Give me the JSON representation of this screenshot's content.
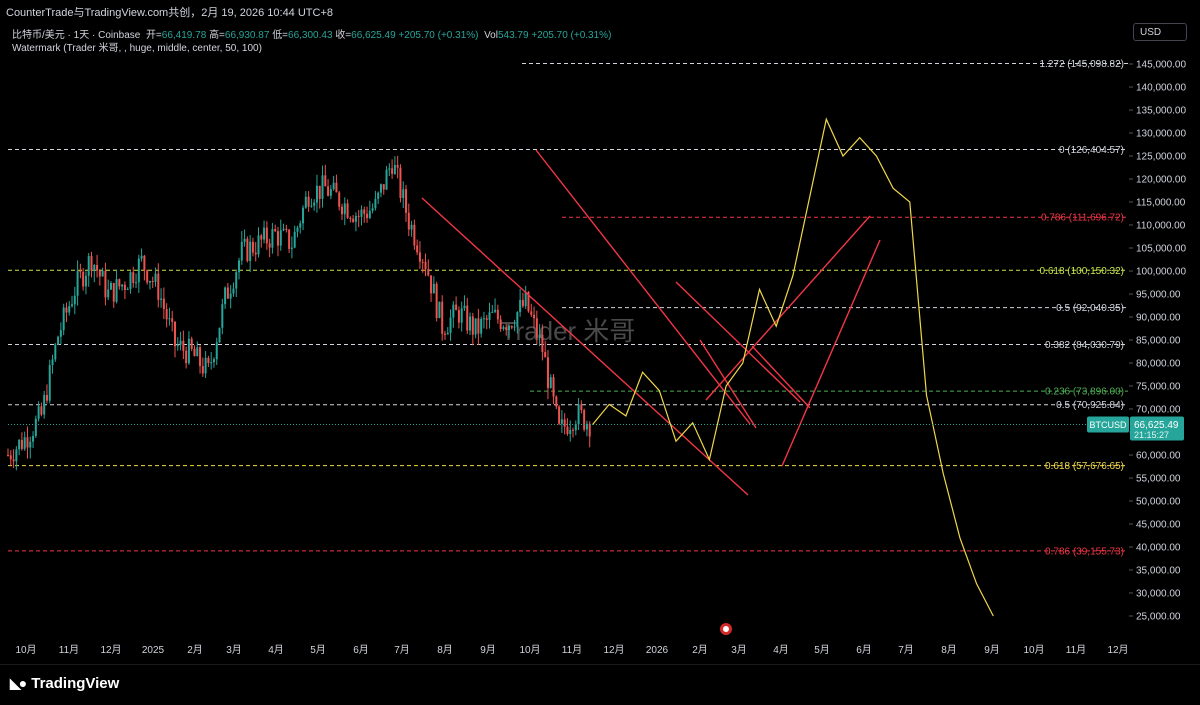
{
  "header": {
    "title": "CounterTrade与TradingView.com共创，2月 19, 2026 10:44 UTC+8",
    "symbol_line": "比特币/美元 · 1天 · Coinbase",
    "open_label": "开=",
    "open": "66,419.78",
    "high_label": "高=",
    "high": "66,930.87",
    "low_label": "低=",
    "low": "66,300.43",
    "close_label": "收=",
    "close": "66,625.49",
    "change": "+205.70 (+0.31%)",
    "vol_label": "Vol",
    "vol": "543.79",
    "vol_change": "+205.70 (+0.31%)",
    "watermark_study": "Watermark (Trader 米哥, , huge, middle, center, 50, 100)",
    "currency": "USD"
  },
  "watermark": "Trader 米哥",
  "footer": {
    "brand": "TradingView"
  },
  "colors": {
    "up": "#26a69a",
    "down": "#ef5350",
    "projection": "#f0d84a",
    "channel": "#f23645",
    "fib_white": "#d1d4dc",
    "fib_red": "#f23645",
    "fib_green": "#4caf50",
    "fib_yellow": "#f0d84a"
  },
  "chart_data": {
    "type": "line",
    "title": "比特币/美元 · 1天 · Coinbase",
    "y_axis": {
      "ticks": [
        "145,000.00",
        "140,000.00",
        "135,000.00",
        "130,000.00",
        "125,000.00",
        "120,000.00",
        "115,000.00",
        "110,000.00",
        "105,000.00",
        "100,000.00",
        "95,000.00",
        "90,000.00",
        "85,000.00",
        "80,000.00",
        "75,000.00",
        "70,000.00",
        "65,000.00",
        "60,000.00",
        "55,000.00",
        "50,000.00",
        "45,000.00",
        "40,000.00",
        "35,000.00",
        "30,000.00",
        "25,000.00"
      ],
      "range": [
        22000,
        150000
      ]
    },
    "x_axis": {
      "ticks": [
        "10月",
        "11月",
        "12月",
        "2025",
        "2月",
        "3月",
        "4月",
        "5月",
        "6月",
        "7月",
        "8月",
        "9月",
        "10月",
        "11月",
        "12月",
        "2026",
        "2月",
        "3月",
        "4月",
        "5月",
        "6月",
        "7月",
        "8月",
        "9月",
        "10月",
        "11月",
        "12月"
      ]
    },
    "last_price": {
      "symbol": "BTCUSD",
      "value": "66,625.49",
      "countdown": "21:15:27"
    },
    "fib_levels": [
      {
        "label": "1.272 (145,098.82)",
        "price": 145098.82,
        "color": "#d1d4dc"
      },
      {
        "label": "0 (126,404.57)",
        "price": 126404.57,
        "color": "#d1d4dc"
      },
      {
        "label": "0.786 (111,696.72)",
        "price": 111696.72,
        "color": "#f23645"
      },
      {
        "label": "0.618 (100,150.32)",
        "price": 100150.32,
        "color": "#c8e64a"
      },
      {
        "label": "0.5 (92,040.35)",
        "price": 92040.35,
        "color": "#d1d4dc"
      },
      {
        "label": "0.382 (84,030.79)",
        "price": 84030.79,
        "color": "#d1d4dc"
      },
      {
        "label": "0.236 (73,896.00)",
        "price": 73896.0,
        "color": "#4caf50"
      },
      {
        "label": "0.5 (70,925.84)",
        "price": 70925.84,
        "color": "#d1d4dc"
      },
      {
        "label": "0.618 (57,676.65)",
        "price": 57676.65,
        "color": "#f0d84a"
      },
      {
        "label": "0.786 (39,155.73)",
        "price": 39155.73,
        "color": "#f23645"
      }
    ],
    "series": [
      {
        "name": "BTCUSD",
        "values": [
          [
            0,
            60000
          ],
          [
            1,
            63500
          ],
          [
            2,
            68500
          ],
          [
            3,
            86000
          ],
          [
            4,
            96000
          ],
          [
            5,
            103000
          ],
          [
            6,
            95000
          ],
          [
            7,
            97500
          ],
          [
            8,
            102000
          ],
          [
            9,
            96000
          ],
          [
            10,
            84000
          ],
          [
            11,
            82000
          ],
          [
            12,
            78000
          ],
          [
            13,
            94000
          ],
          [
            14,
            104000
          ],
          [
            15,
            106000
          ],
          [
            16,
            108000
          ],
          [
            17,
            106000
          ],
          [
            18,
            117000
          ],
          [
            19,
            118000
          ],
          [
            20,
            115000
          ],
          [
            21,
            112000
          ],
          [
            22,
            114000
          ],
          [
            23,
            124000
          ],
          [
            24,
            111000
          ],
          [
            25,
            102000
          ],
          [
            26,
            88000
          ],
          [
            27,
            91000
          ],
          [
            28,
            87000
          ],
          [
            29,
            90000
          ],
          [
            30,
            89000
          ],
          [
            31,
            93000
          ],
          [
            32,
            83000
          ],
          [
            33,
            65000
          ],
          [
            34,
            69000
          ],
          [
            35,
            66600
          ]
        ]
      },
      {
        "name": "projection",
        "values": [
          [
            35,
            66600
          ],
          [
            36,
            71000
          ],
          [
            37,
            68500
          ],
          [
            38,
            78000
          ],
          [
            39,
            74000
          ],
          [
            40,
            63000
          ],
          [
            41,
            67000
          ],
          [
            42,
            59000
          ],
          [
            43,
            75000
          ],
          [
            44,
            80000
          ],
          [
            45,
            96000
          ],
          [
            46,
            88000
          ],
          [
            47,
            99000
          ],
          [
            48,
            116000
          ],
          [
            49,
            133000
          ],
          [
            50,
            125000
          ],
          [
            51,
            129000
          ],
          [
            52,
            125000
          ],
          [
            53,
            118000
          ],
          [
            54,
            115000
          ],
          [
            55,
            73000
          ],
          [
            56,
            56000
          ],
          [
            57,
            42000
          ],
          [
            58,
            32000
          ],
          [
            59,
            25000
          ]
        ]
      }
    ]
  }
}
